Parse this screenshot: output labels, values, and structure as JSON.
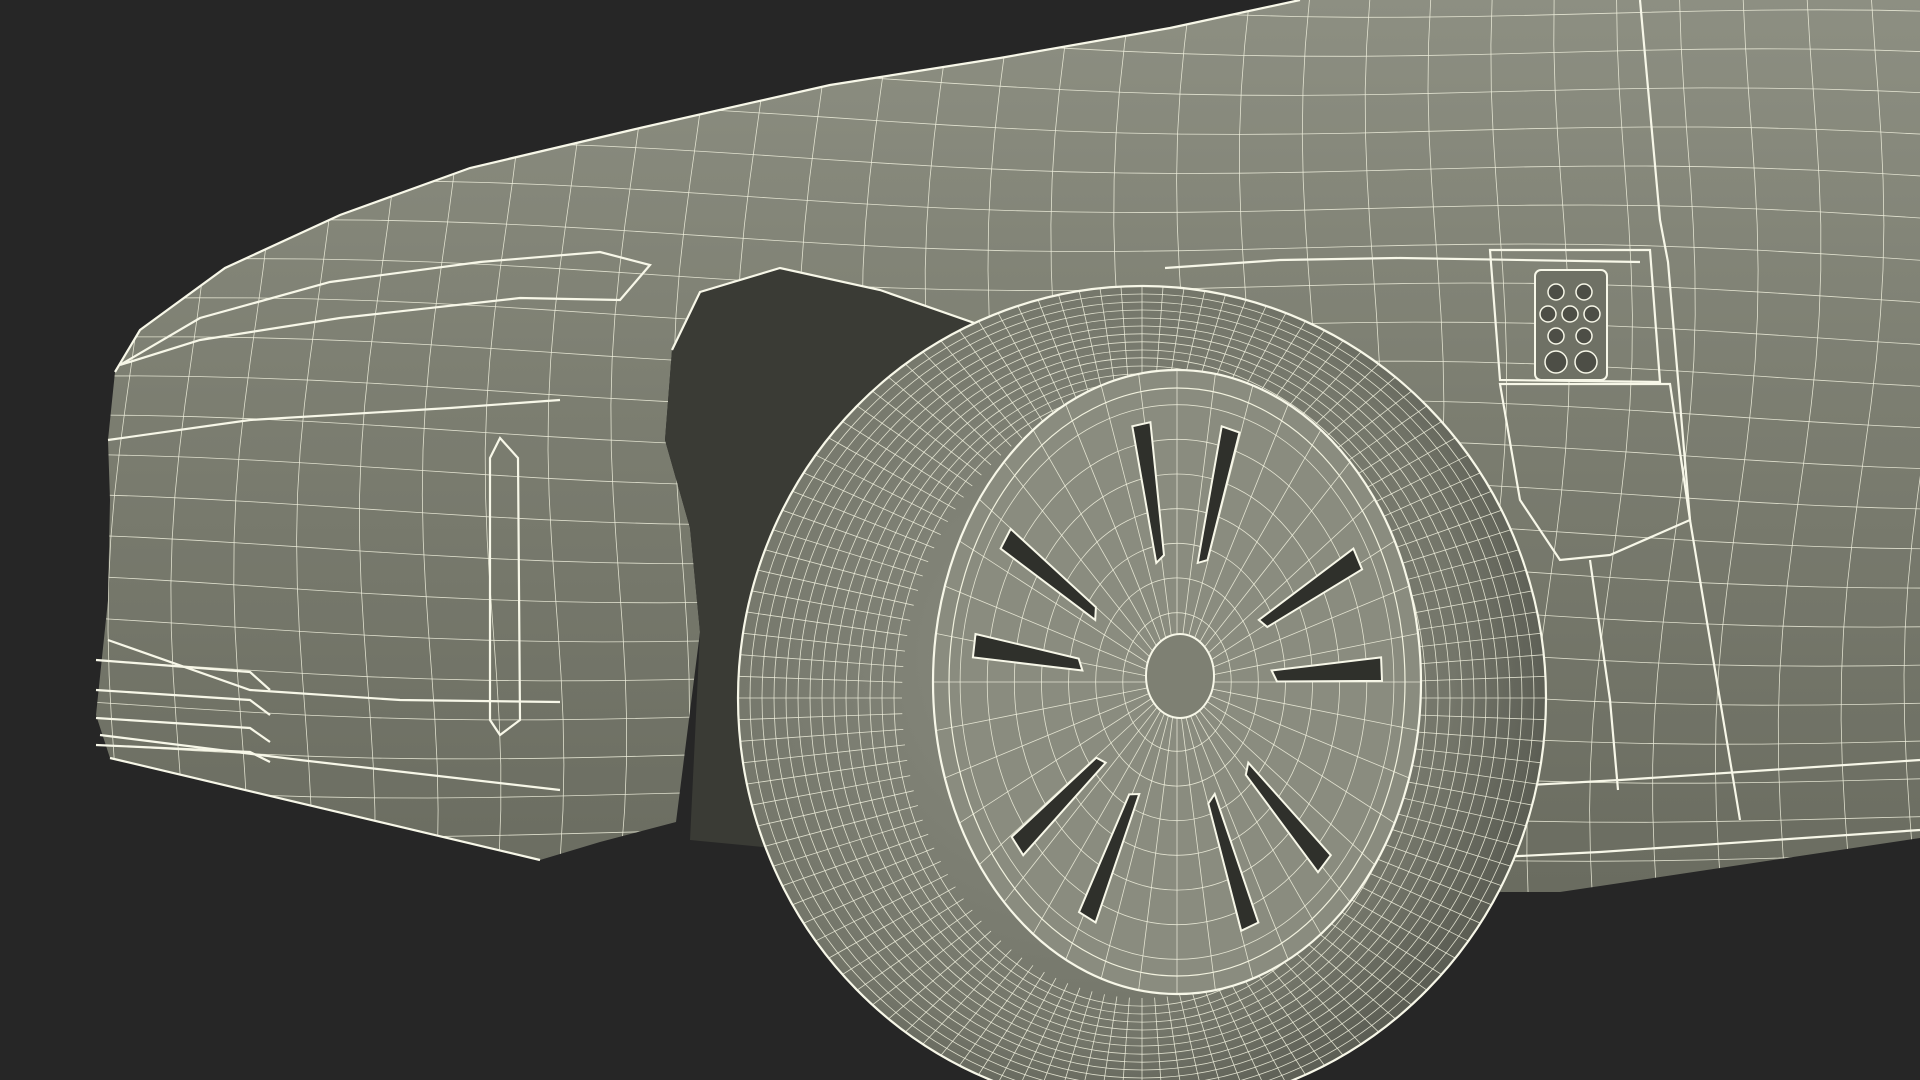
{
  "scene": {
    "background_color": "#262626",
    "body_color": "#7c7e71",
    "body_shadow_color": "#5f6157",
    "body_highlight_color": "#8d8f82",
    "wire_color": "#f2f2df",
    "tire_color": "#74766a",
    "wheel_face_color": "#8a8c7f",
    "opening_color": "#3a3b35"
  }
}
